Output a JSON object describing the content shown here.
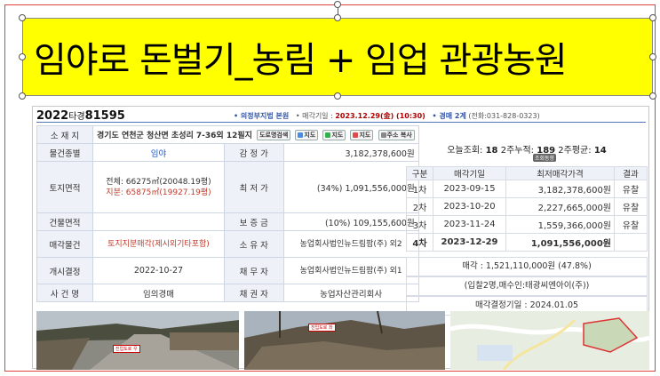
{
  "banner": {
    "title": "임야로 돈벌기_농림 + 임업  관광농원"
  },
  "header": {
    "case_prefix": "2022",
    "case_type": "타경",
    "case_no": "81595",
    "court": "• 의정부지법 본원",
    "sale_date_label": "• 매각기일 :",
    "sale_date": "2023.12.29(金) (10:30)",
    "dept": "• 경매 2계",
    "phone": "(전화:031-828-0323)"
  },
  "info": {
    "address_label": "소 재 지",
    "address": "경기도 연천군 청산면 초성리 7-36외 12필지",
    "buttons": [
      "도로명검색",
      "지도",
      "지도",
      "지도",
      "주소 복사"
    ],
    "rows": [
      {
        "l1": "물건종별",
        "v1": "임야",
        "l2": "감 정 가",
        "v2": "3,182,378,600원"
      },
      {
        "l1": "토지면적",
        "v1a": "전체: 66275㎡(20048.19평)",
        "v1b": "지분: 65875㎡(19927.19평)",
        "l2": "최 저 가",
        "v2": "(34%) 1,091,556,000원"
      },
      {
        "l1": "건물면적",
        "v1": "",
        "l2": "보 증 금",
        "v2": "(10%) 109,155,600원"
      },
      {
        "l1": "매각물건",
        "v1": "토지지분매각(제시외기타포함)",
        "l2": "소 유 자",
        "v2": "농업회사법인뉴드림팜(주) 외2"
      },
      {
        "l1": "개시결정",
        "v1": "2022-10-27",
        "l2": "채 무 자",
        "v2": "농업회사법인뉴드림팜(주) 외1"
      },
      {
        "l1": "사 건 명",
        "v1": "임의경매",
        "l2": "채 권 자",
        "v2": "농업자산관리회사"
      }
    ]
  },
  "stats": {
    "today_label": "오늘조회:",
    "today": "18",
    "week2_label": "2주누적:",
    "week2": "189",
    "avg_label": "2주평균:",
    "avg": "14",
    "lookup_btn": "조회동향"
  },
  "history": {
    "headers": [
      "구분",
      "매각기일",
      "최저매각가격",
      "결과"
    ],
    "rows": [
      {
        "round": "1차",
        "date": "2023-09-15",
        "price": "3,182,378,600원",
        "result": "유찰"
      },
      {
        "round": "2차",
        "date": "2023-10-20",
        "price": "2,227,665,000원",
        "result": "유찰"
      },
      {
        "round": "3차",
        "date": "2023-11-24",
        "price": "1,559,366,000원",
        "result": "유찰"
      },
      {
        "round": "4차",
        "date": "2023-12-29",
        "price": "1,091,556,000원",
        "result": ""
      }
    ],
    "sold": "매각 : 1,521,110,000원 (47.8%)",
    "bidders": "(입찰2명,매수인:태광씨엔아이(주))",
    "decision": "매각결정기일 : 2024.01.05"
  },
  "photos": {
    "captions": [
      "진입도로 우",
      "진입도로 좌"
    ]
  },
  "colors": {
    "banner": "#ffff00",
    "accent": "#3657a7",
    "red": "#c23a2b"
  }
}
